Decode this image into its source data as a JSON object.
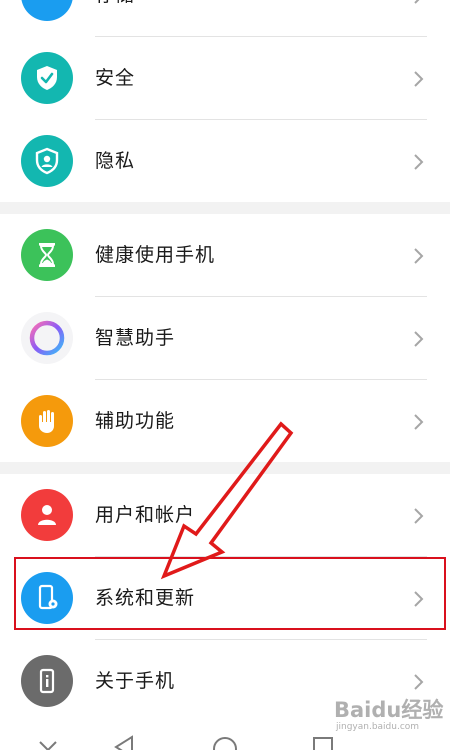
{
  "settings": {
    "items": [
      {
        "label": "存储",
        "icon": "storage-icon",
        "color": "#1a9df0"
      },
      {
        "label": "安全",
        "icon": "shield-check-icon",
        "color": "#13b7b0"
      },
      {
        "label": "隐私",
        "icon": "privacy-shield-icon",
        "color": "#13b7b0"
      },
      {
        "label": "健康使用手机",
        "icon": "hourglass-icon",
        "color": "#3cc25a"
      },
      {
        "label": "智慧助手",
        "icon": "assistant-ring-icon",
        "color": "#8b5cf6"
      },
      {
        "label": "辅助功能",
        "icon": "hand-icon",
        "color": "#f59a0c"
      },
      {
        "label": "用户和帐户",
        "icon": "user-icon",
        "color": "#f23c3c"
      },
      {
        "label": "系统和更新",
        "icon": "system-update-icon",
        "color": "#1a9df0"
      },
      {
        "label": "关于手机",
        "icon": "phone-info-icon",
        "color": "#6b6b6b"
      }
    ]
  },
  "annotation": {
    "highlight_color": "#d9101d"
  },
  "watermark": {
    "logo": "Baidu经验",
    "url": "jingyan.baidu.com"
  }
}
